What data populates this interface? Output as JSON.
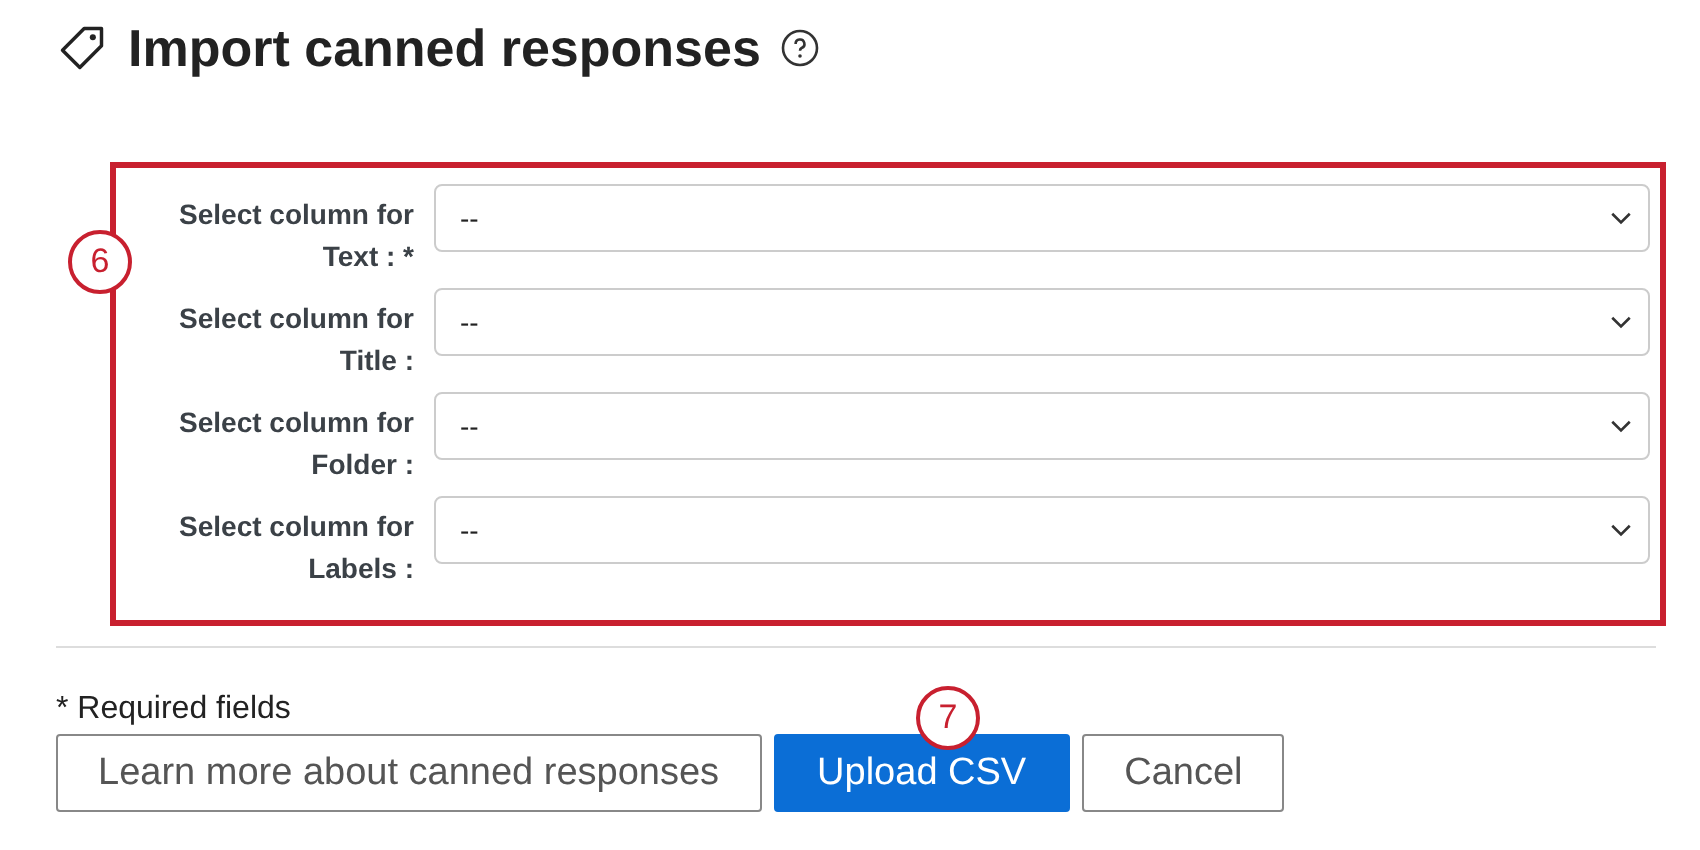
{
  "title": "Import canned responses",
  "fields": [
    {
      "label_line1": "Select column for",
      "label_line2": "Text : *",
      "value": "--"
    },
    {
      "label_line1": "Select column for",
      "label_line2": "Title :",
      "value": "--"
    },
    {
      "label_line1": "Select column for",
      "label_line2": "Folder :",
      "value": "--"
    },
    {
      "label_line1": "Select column for",
      "label_line2": "Labels :",
      "value": "--"
    }
  ],
  "callouts": [
    {
      "number": "6"
    },
    {
      "number": "7"
    }
  ],
  "required_note": "* Required fields",
  "buttons": [
    {
      "label": "Learn more about canned responses",
      "kind": "secondary"
    },
    {
      "label": "Upload CSV",
      "kind": "primary"
    },
    {
      "label": "Cancel",
      "kind": "secondary"
    }
  ]
}
